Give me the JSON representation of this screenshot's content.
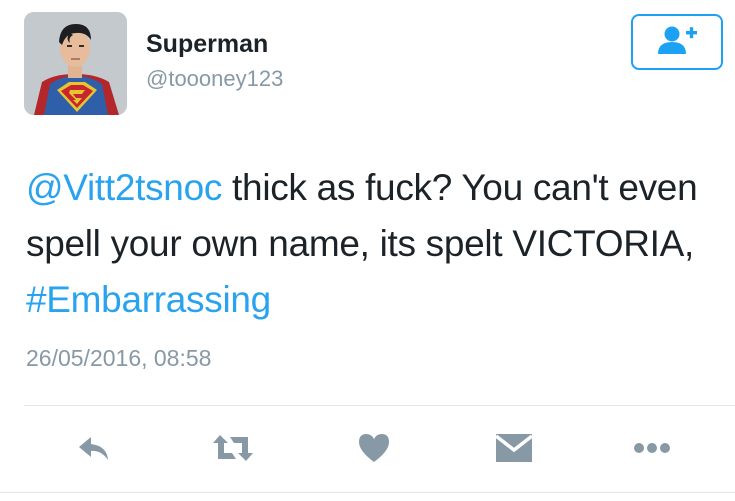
{
  "user": {
    "name": "Superman",
    "handle": "@toooney123"
  },
  "follow_button": {
    "icon": "follow-user-icon"
  },
  "tweet": {
    "mention": "@Vitt2tsnoc",
    "text_part1": " thick as fuck? You can't even spell your own name, its spelt VICTORIA, ",
    "hashtag": "#Embarrassing",
    "timestamp": "26/05/2016, 08:58"
  },
  "actions": [
    {
      "icon": "reply-icon"
    },
    {
      "icon": "retweet-icon"
    },
    {
      "icon": "like-icon"
    },
    {
      "icon": "direct-message-icon"
    },
    {
      "icon": "more-icon"
    }
  ],
  "colors": {
    "accent": "#1da1f2",
    "link": "#2aa3ef",
    "text": "#1c2328",
    "muted": "#8899a6",
    "icon": "#8899a6"
  }
}
